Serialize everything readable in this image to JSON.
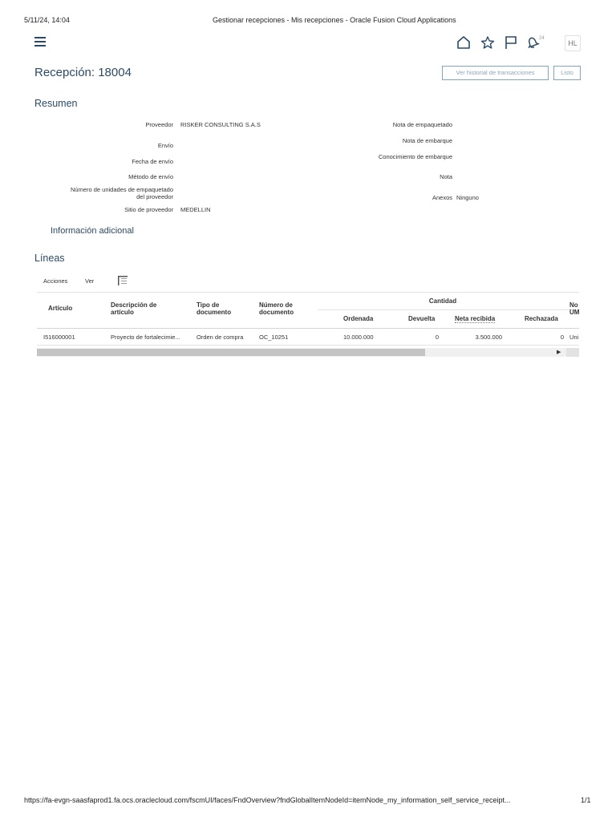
{
  "print_header": {
    "datetime": "5/11/24, 14:04",
    "page_title": "Gestionar recepciones - Mis recepciones - Oracle Fusion Cloud Applications"
  },
  "topbar": {
    "notification_count": "24",
    "user_initials": "HL"
  },
  "page": {
    "title": "Recepción: 18004",
    "history_button": "Ver historial de transacciones",
    "done_button": "Listo"
  },
  "summary": {
    "title": "Resumen",
    "left_fields": [
      {
        "label": "Proveedor",
        "value": "RISKER CONSULTING S.A.S"
      },
      {
        "label": "Envío",
        "value": ""
      },
      {
        "label": "Fecha de envío",
        "value": ""
      },
      {
        "label": "Método de envío",
        "value": ""
      },
      {
        "label_line1": "Número de unidades de empaquetado",
        "label_line2": "del proveedor",
        "value": ""
      },
      {
        "label": "Sitio de proveedor",
        "value": "MEDELLIN"
      }
    ],
    "right_fields": [
      {
        "label": "Nota de empaquetado",
        "value": ""
      },
      {
        "label": "Nota de embarque",
        "value": ""
      },
      {
        "label": "Conocimiento de embarque",
        "value": ""
      },
      {
        "label": "Nota",
        "value": ""
      },
      {
        "label": "Anexos",
        "value": "Ninguno"
      }
    ],
    "additional_info": "Información adicional"
  },
  "lines": {
    "title": "Líneas",
    "toolbar": {
      "actions": "Acciones",
      "view": "Ver"
    },
    "headers": {
      "item": "Artículo",
      "description_l1": "Descripción de",
      "description_l2": "artículo",
      "doc_type_l1": "Tipo de",
      "doc_type_l2": "documento",
      "doc_number_l1": "Número de",
      "doc_number_l2": "documento",
      "quantity": "Cantidad",
      "ordered": "Ordenada",
      "returned": "Devuelta",
      "net_received": "Neta recibida",
      "rejected": "Rechazada",
      "uom_l1": "No",
      "uom_l2": "UM"
    },
    "rows": [
      {
        "item": "I516000001",
        "description": "Proyecto de fortalecimie...",
        "doc_type": "Orden de compra",
        "doc_number": "OC_10251",
        "ordered": "10.000.000",
        "returned": "0",
        "net_received": "3.500.000",
        "rejected": "0",
        "uom": "Uni"
      }
    ]
  },
  "print_footer": {
    "url": "https://fa-evgn-saasfaprod1.fa.ocs.oraclecloud.com/fscmUI/faces/FndOverview?fndGlobalItemNodeId=itemNode_my_information_self_service_receipt...",
    "page": "1/1"
  },
  "colors": {
    "accent": "#2a4a66",
    "button_border": "#7fa7c4"
  },
  "icons": [
    "hamburger-menu-icon",
    "home-icon",
    "star-icon",
    "flag-icon",
    "bell-icon",
    "column-freeze-icon"
  ]
}
